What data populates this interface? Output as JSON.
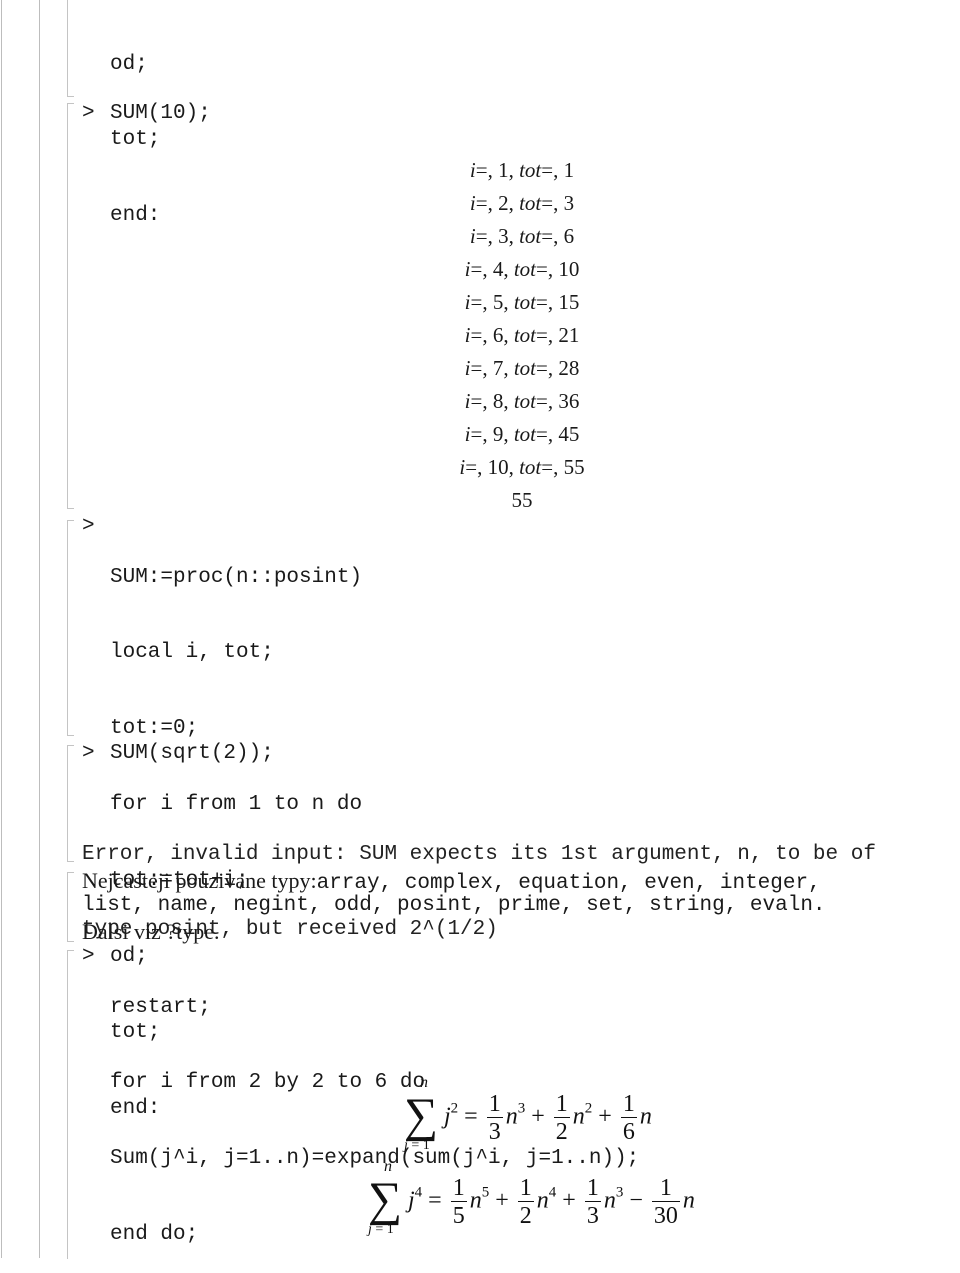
{
  "blocks": {
    "proc_tail_top": [
      "od;",
      "tot;",
      "end:"
    ],
    "call_1": {
      "prompt": ">",
      "input": "SUM(10);",
      "output_lines": [
        {
          "i": "1",
          "tot": "1"
        },
        {
          "i": "2",
          "tot": "3"
        },
        {
          "i": "3",
          "tot": "6"
        },
        {
          "i": "4",
          "tot": "10"
        },
        {
          "i": "5",
          "tot": "15"
        },
        {
          "i": "6",
          "tot": "21"
        },
        {
          "i": "7",
          "tot": "28"
        },
        {
          "i": "8",
          "tot": "36"
        },
        {
          "i": "9",
          "tot": "45"
        },
        {
          "i": "10",
          "tot": "55"
        }
      ],
      "output_labels": {
        "i": "i",
        "tot": "tot",
        "eq": "=, "
      },
      "result": "55"
    },
    "proc_def": {
      "prompt": ">",
      "lines": [
        "SUM:=proc(n::posint)",
        "local i, tot;",
        "tot:=0;",
        "for i from 1 to n do",
        "tot:=tot+i;",
        "od;",
        "tot;",
        "end:"
      ]
    },
    "call_2": {
      "prompt": ">",
      "input": "SUM(sqrt(2));",
      "error_lines": [
        "Error, invalid input: SUM expects its 1st argument, n, to be of",
        "type posint, but received 2^(1/2)"
      ]
    },
    "note": {
      "label": "Nejcasteji pouzivane typy:",
      "types_line1": "array, complex, equation, even, integer,",
      "types_line2": "list, name, negint, odd, posint, prime, set, string, evaln.",
      "footer": "Dalsi viz ?type."
    },
    "loop": {
      "prompt": ">",
      "lines": [
        "restart;",
        "for i from 2 by 2 to 6 do",
        "Sum(j^i, j=1..n)=expand(sum(j^i, j=1..n));",
        "end do;"
      ]
    },
    "formulas": [
      {
        "sum_upper": "n",
        "sum_lower_var": "j",
        "sum_lower": " = 1",
        "base": "j",
        "power": "2",
        "terms": [
          {
            "sign": "=",
            "num": "1",
            "den": "3",
            "var": "n",
            "exp": "3"
          },
          {
            "sign": "+",
            "num": "1",
            "den": "2",
            "var": "n",
            "exp": "2"
          },
          {
            "sign": "+",
            "num": "1",
            "den": "6",
            "var": "n",
            "exp": ""
          }
        ]
      },
      {
        "sum_upper": "n",
        "sum_lower_var": "j",
        "sum_lower": " = 1",
        "base": "j",
        "power": "4",
        "terms": [
          {
            "sign": "=",
            "num": "1",
            "den": "5",
            "var": "n",
            "exp": "5"
          },
          {
            "sign": "+",
            "num": "1",
            "den": "2",
            "var": "n",
            "exp": "4"
          },
          {
            "sign": "+",
            "num": "1",
            "den": "3",
            "var": "n",
            "exp": "3"
          },
          {
            "sign": "−",
            "num": "1",
            "den": "30",
            "var": "n",
            "exp": ""
          }
        ]
      }
    ]
  }
}
